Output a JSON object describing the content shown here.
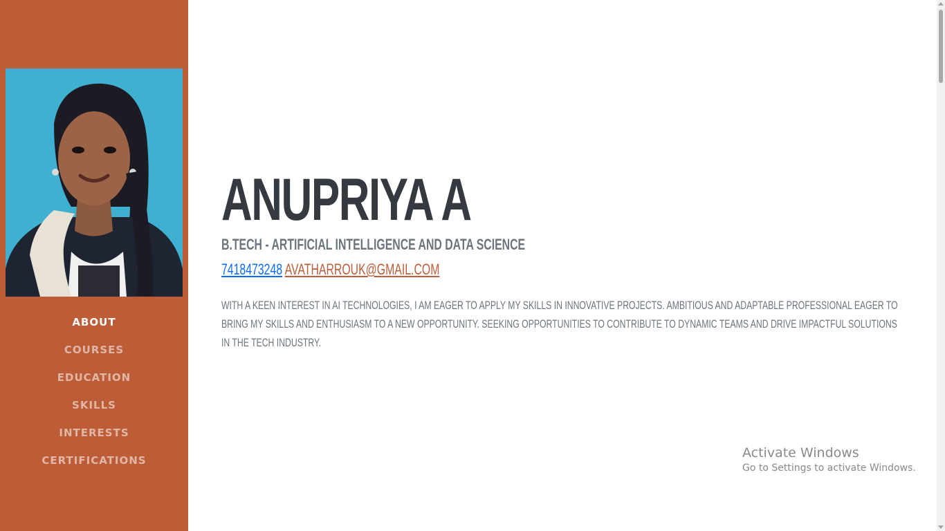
{
  "sidebar": {
    "photo_alt": "profile photo",
    "nav": [
      {
        "label": "ABOUT",
        "active": true
      },
      {
        "label": "COURSES",
        "active": false
      },
      {
        "label": "EDUCATION",
        "active": false
      },
      {
        "label": "SKILLS",
        "active": false
      },
      {
        "label": "INTERESTS",
        "active": false
      },
      {
        "label": "CERTIFICATIONS",
        "active": false
      }
    ]
  },
  "about": {
    "name": "ANUPRIYA A",
    "subtitle": "B.TECH - ARTIFICIAL INTELLIGENCE AND DATA SCIENCE",
    "phone": "7418473248",
    "email": "AVATHARROUK@GMAIL.COM",
    "summary": "WITH A KEEN INTEREST IN AI TECHNOLOGIES, I AM EAGER TO APPLY MY SKILLS IN INNOVATIVE PROJECTS. AMBITIOUS AND ADAPTABLE PROFESSIONAL EAGER TO BRING MY SKILLS AND ENTHUSIASM TO A NEW OPPORTUNITY. SEEKING OPPORTUNITIES TO CONTRIBUTE TO DYNAMIC TEAMS AND DRIVE IMPACTFUL SOLUTIONS IN THE TECH INDUSTRY."
  },
  "watermark": {
    "title": "Activate Windows",
    "subtitle": "Go to Settings to activate Windows."
  },
  "colors": {
    "sidebar_bg": "#bd5d38",
    "name_text": "#343a40",
    "muted_text": "#6c757d",
    "phone_link": "#0d6efd",
    "email_link": "#bd5d38"
  }
}
